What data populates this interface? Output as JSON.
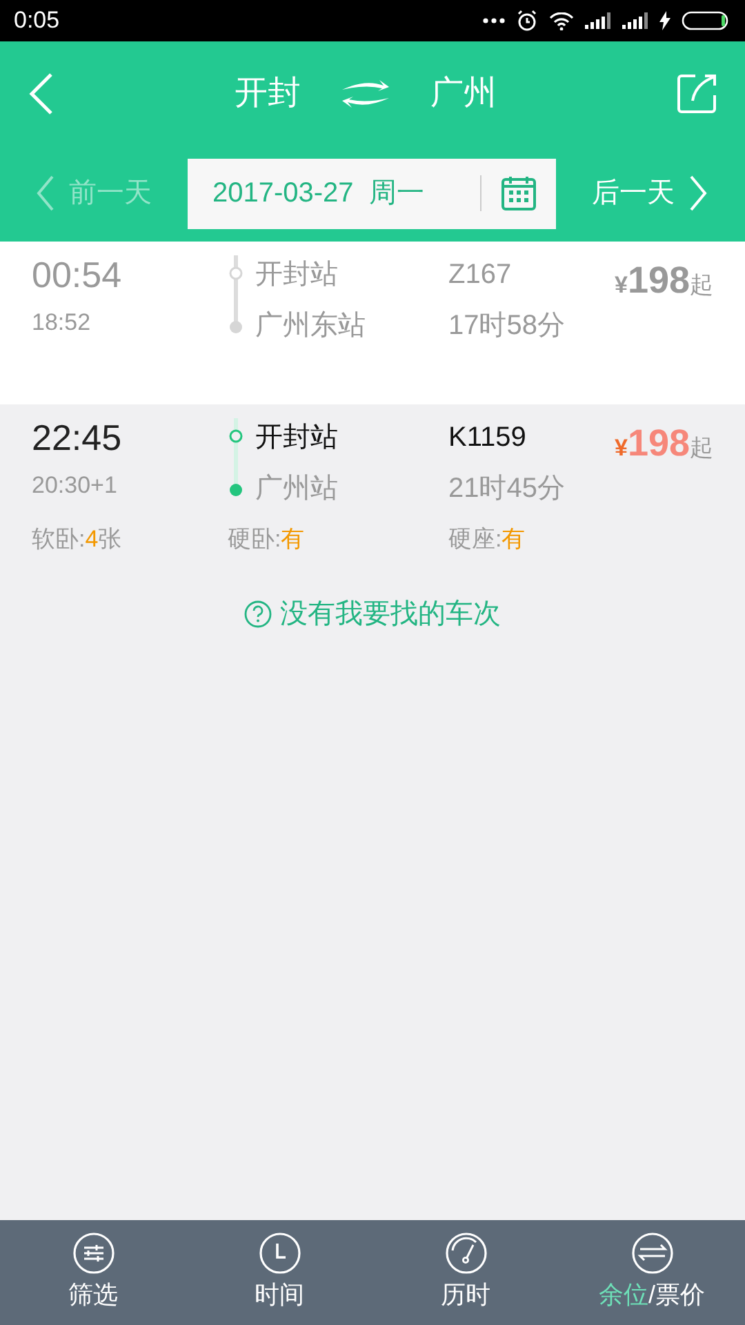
{
  "status_bar": {
    "time": "0:05"
  },
  "header": {
    "from": "开封",
    "to": "广州"
  },
  "date_bar": {
    "prev": {
      "label": "前一天",
      "disabled": true
    },
    "date": "2017-03-27",
    "weekday": "周一",
    "next": {
      "label": "后一天",
      "disabled": false
    }
  },
  "trains": [
    {
      "depart": "00:54",
      "arrive": "18:52",
      "from_station": "开封站",
      "to_station": "广州东站",
      "number": "Z167",
      "duration": "17时58分",
      "price_symbol": "¥",
      "price": "198",
      "price_suffix": "起",
      "available": false
    },
    {
      "depart": "22:45",
      "arrive": "20:30+1",
      "from_station": "开封站",
      "to_station": "广州站",
      "number": "K1159",
      "duration": "21时45分",
      "price_symbol": "¥",
      "price": "198",
      "price_suffix": "起",
      "available": true,
      "seats": [
        {
          "label": "软卧:",
          "count": "4",
          "unit": "张"
        },
        {
          "label": "硬卧:",
          "count": "有"
        },
        {
          "label": "硬座:",
          "count": "有"
        }
      ]
    }
  ],
  "help_link": "没有我要找的车次",
  "tabs": [
    {
      "kind": "filter",
      "label": "筛选",
      "selected": false
    },
    {
      "kind": "time",
      "label": "时间",
      "selected": false
    },
    {
      "kind": "duration",
      "label": "历时",
      "selected": false
    },
    {
      "kind": "swap",
      "label": "余位",
      "sublabel": "/票价",
      "selected": true
    }
  ]
}
